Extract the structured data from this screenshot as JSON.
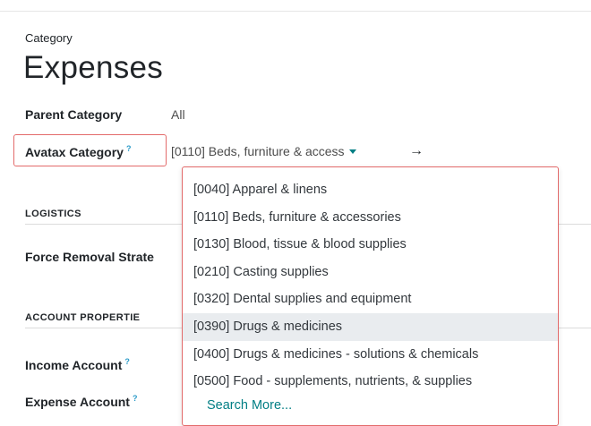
{
  "form": {
    "category_label": "Category",
    "title": "Expenses",
    "parent_category_label": "Parent Category",
    "parent_category_value": "All",
    "avatax_category_label": "Avatax Category",
    "help_marker": "?",
    "avatax_category_value": "[0110] Beds, furniture & access",
    "external_link_glyph": "→"
  },
  "sections": {
    "logistics": "LOGISTICS",
    "force_removal_label": "Force Removal Strate",
    "account_properties": "ACCOUNT PROPERTIE",
    "income_account_label": "Income Account",
    "expense_account_label": "Expense Account"
  },
  "dropdown": {
    "options": [
      "[0040] Apparel & linens",
      "[0110] Beds, furniture & accessories",
      "[0130] Blood, tissue & blood supplies",
      "[0210] Casting supplies",
      "[0320] Dental supplies and equipment",
      "[0390] Drugs & medicines",
      "[0400] Drugs & medicines - solutions & chemicals",
      "[0500] Food - supplements, nutrients, & supplies"
    ],
    "highlighted_index": 5,
    "search_more": "Search More..."
  },
  "colors": {
    "accent": "#017e84",
    "help_marker": "#2b9bc8",
    "highlight_border": "#e36b6b",
    "active_option_bg": "#e9ecef"
  },
  "icons": {
    "caret": "caret-down-icon",
    "external": "arrow-right-icon"
  }
}
